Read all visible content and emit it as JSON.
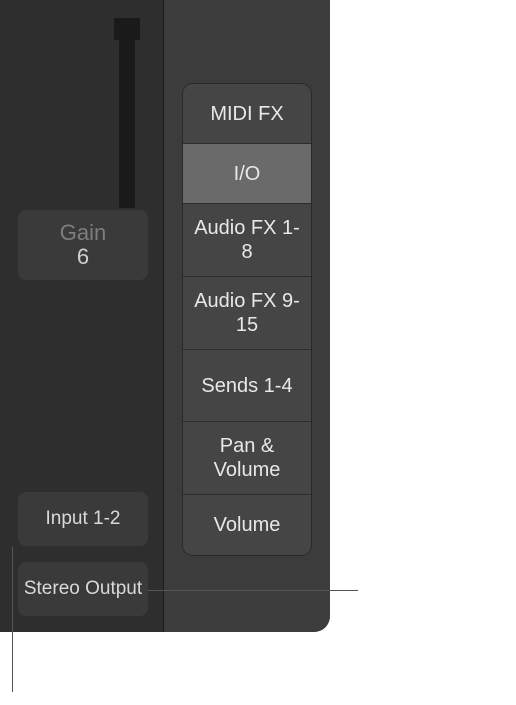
{
  "channel": {
    "gain_label": "Gain",
    "gain_value": "6",
    "input_label": "Input 1-2",
    "output_label": "Stereo Output"
  },
  "menu": {
    "items": [
      {
        "label": "MIDI FX",
        "selected": false,
        "tall": false
      },
      {
        "label": "I/O",
        "selected": true,
        "tall": false
      },
      {
        "label": "Audio FX 1-8",
        "selected": false,
        "tall": true
      },
      {
        "label": "Audio FX 9-15",
        "selected": false,
        "tall": true
      },
      {
        "label": "Sends 1-4",
        "selected": false,
        "tall": true
      },
      {
        "label": "Pan & Volume",
        "selected": false,
        "tall": true
      },
      {
        "label": "Volume",
        "selected": false,
        "tall": false
      }
    ]
  }
}
